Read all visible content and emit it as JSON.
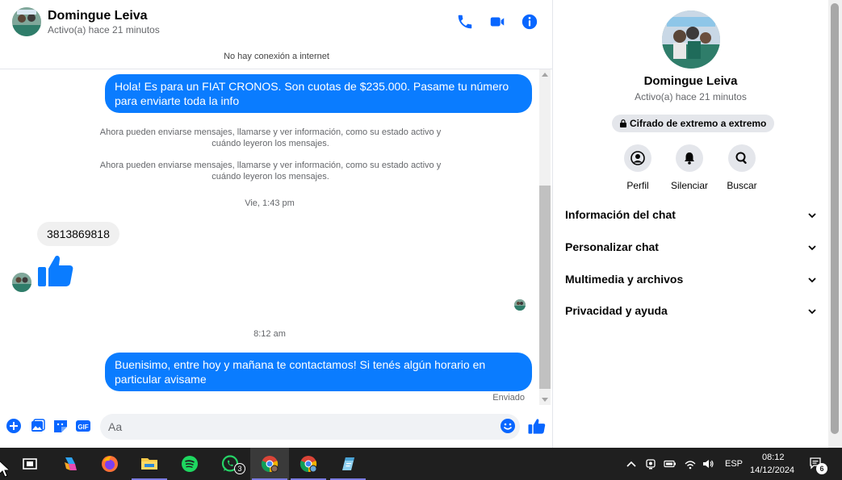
{
  "contact": {
    "name": "Domingue Leiva",
    "status": "Activo(a) hace 21 minutos"
  },
  "banner": "No hay conexión a internet",
  "messages": {
    "out1": "Hola! Es para un FIAT CRONOS. Son cuotas de $235.000. Pasame tu número para enviarte toda la info",
    "sys1": "Ahora pueden enviarse mensajes, llamarse y ver información, como su estado activo y cuándo leyeron los mensajes.",
    "sys2": "Ahora pueden enviarse mensajes, llamarse y ver información, como su estado activo y cuándo leyeron los mensajes.",
    "time1": "Vie, 1:43 pm",
    "in1": "3813869818",
    "time2": "8:12 am",
    "out2": "Buenisimo, entre hoy y mañana te contactamos! Si tenés algún horario en particular avisame",
    "sent_status": "Enviado"
  },
  "composer": {
    "placeholder": "Aa"
  },
  "info_panel": {
    "encryption": "Cifrado de extremo a extremo",
    "actions": [
      "Perfil",
      "Silenciar",
      "Buscar"
    ],
    "sections": [
      "Información del chat",
      "Personalizar chat",
      "Multimedia y archivos",
      "Privacidad y ayuda"
    ]
  },
  "taskbar": {
    "whatsapp_badge": "3",
    "language": "ESP",
    "time": "08:12",
    "date": "14/12/2024",
    "notifications": "6"
  },
  "colors": {
    "accent": "#0a7cff",
    "icon_blue": "#0866ff"
  }
}
